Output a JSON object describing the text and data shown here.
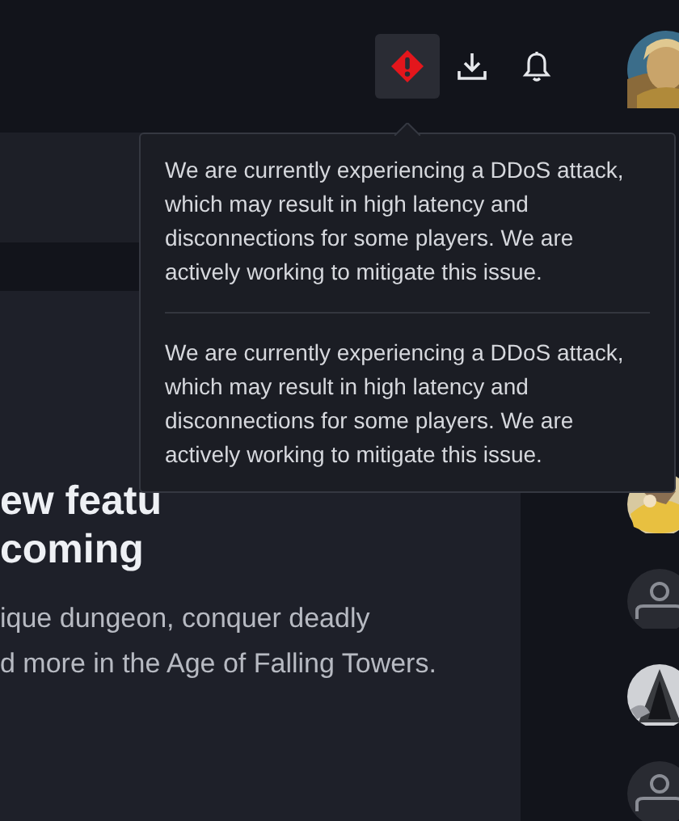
{
  "top_bar": {
    "buttons": [
      {
        "kind": "alert",
        "selected": true
      },
      {
        "kind": "download",
        "selected": false
      },
      {
        "kind": "notifications",
        "selected": false
      }
    ]
  },
  "alert_popup": {
    "messages": [
      "We are currently experiencing a DDoS attack, which may result in high latency and disconnections for some players. We are actively working to mitigate this issue.",
      "We are currently experiencing a DDoS attack, which may result in high latency and disconnections for some players. We are actively working to mitigate this issue."
    ]
  },
  "feature_card": {
    "heading_lines": [
      "ew featu",
      "coming"
    ],
    "description_lines": [
      "ique dungeon, conquer deadly",
      "d more in the Age of Falling Towers."
    ]
  },
  "friends": [
    {
      "kind": "picture"
    },
    {
      "kind": "placeholder"
    },
    {
      "kind": "picture"
    },
    {
      "kind": "placeholder"
    }
  ]
}
